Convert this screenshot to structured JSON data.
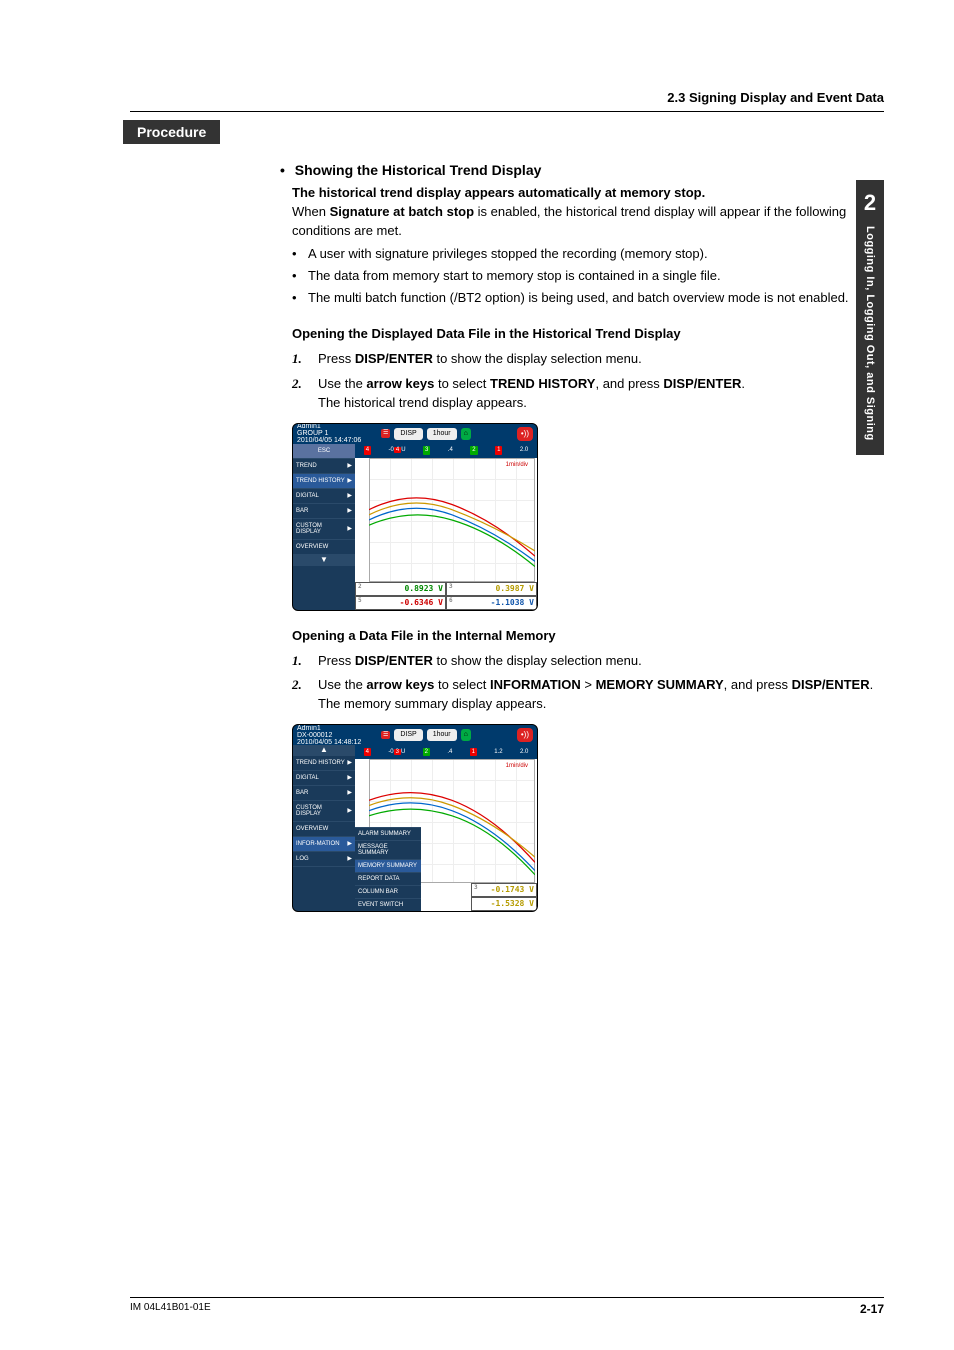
{
  "header": {
    "section": "2.3  Signing Display and Event Data"
  },
  "procedure_label": "Procedure",
  "showing": {
    "title": "Showing the Historical Trend Display",
    "line1": "The historical trend display appears automatically at memory stop.",
    "line2a": "When ",
    "line2b": "Signature at batch stop",
    "line2c": " is enabled, the historical trend display will appear if the following conditions are met.",
    "bullets": {
      "b1": "A user with signature privileges stopped the recording (memory stop).",
      "b2": "The data from memory start to memory stop is contained in a single file.",
      "b3": "The multi batch function (/BT2 option) is being used, and batch overview mode is not enabled."
    }
  },
  "opening1": {
    "heading": "Opening the Displayed Data File in the Historical Trend Display",
    "s1a": "Press ",
    "s1b": "DISP/ENTER",
    "s1c": " to show the display selection menu.",
    "s2a": "Use the ",
    "s2b": "arrow keys",
    "s2c": " to select ",
    "s2d": "TREND HISTORY",
    "s2e": ", and press ",
    "s2f": "DISP/ENTER",
    "s2g": ".",
    "note": "The historical trend display appears."
  },
  "opening2": {
    "heading": "Opening a Data File in the Internal Memory",
    "s1a": "Press ",
    "s1b": "DISP/ENTER",
    "s1c": " to show the display selection menu.",
    "s2a": "Use the ",
    "s2b": "arrow keys",
    "s2c": " to select ",
    "s2d": "INFORMATION",
    "s2e": " > ",
    "s2f": "MEMORY SUMMARY",
    "s2g": ", and press ",
    "s2h": "DISP/ENTER",
    "s2i": ".",
    "note": "The memory summary display appears."
  },
  "screenshot1": {
    "top_left": "Admin1\nGROUP 1\n2010/04/05 14:47:06",
    "disp": "DISP",
    "time": "1hour",
    "menu": {
      "esc": "ESC",
      "trend": "TREND",
      "trend_history": "TREND HISTORY",
      "digital": "DIGITAL",
      "bar": "BAR",
      "custom": "CUSTOM DISPLAY",
      "overview": "OVERVIEW",
      "down": "▼"
    },
    "vals": {
      "v1": "0.8923 V",
      "v2": "0.3987 V",
      "v3": "-0.6346 V",
      "v4": "-1.1038 V"
    },
    "ruler": {
      "t1": "4",
      "t2": "4",
      "t3": "3",
      "t4": "2",
      "t5": "1",
      "r1": "2.0"
    },
    "scale": "1min/div"
  },
  "screenshot2": {
    "top_left": "Admin1\nDX-000012\n2010/04/05 14:48:12",
    "disp": "DISP",
    "time": "1hour",
    "menu": {
      "up": "▲",
      "trend_history": "TREND HISTORY",
      "digital": "DIGITAL",
      "bar": "BAR",
      "custom": "CUSTOM DISPLAY",
      "overview": "OVERVIEW",
      "info": "INFOR-MATION",
      "log": "LOG"
    },
    "submenu": {
      "alarm": "ALARM SUMMARY",
      "msg": "MESSAGE SUMMARY",
      "mem": "MEMORY SUMMARY",
      "report": "REPORT DATA",
      "col": "COLUMN BAR",
      "event": "EVENT SWITCH"
    },
    "vals": {
      "v1": "-0.1743 V",
      "v2": "-1.5328 V"
    },
    "ruler": {
      "t1": "4",
      "t2": "3",
      "t3": "2",
      "t4": "1",
      "r0": "1.2",
      "r1": "2.0"
    },
    "scale": "1min/div"
  },
  "side": {
    "num": "2",
    "text": "Logging In, Logging Out, and Signing"
  },
  "footer": {
    "doc": "IM 04L41B01-01E",
    "page": "2-17"
  }
}
